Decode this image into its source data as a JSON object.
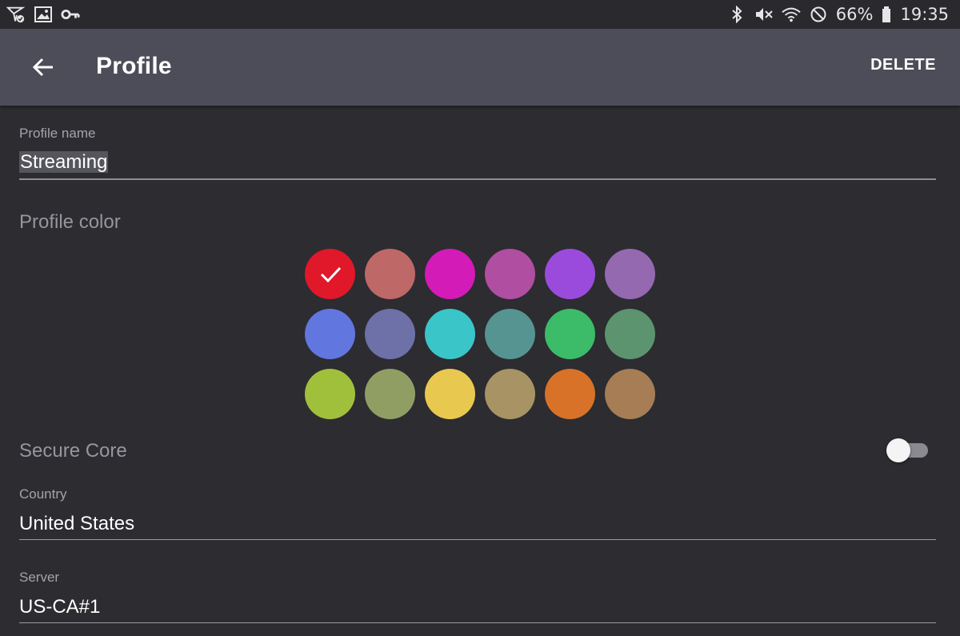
{
  "status_bar": {
    "left_icons": [
      "send-check-icon",
      "image-icon",
      "key-icon"
    ],
    "right_icons": [
      "bluetooth-icon",
      "mute-icon",
      "wifi-icon",
      "do-not-disturb-icon",
      "battery-icon"
    ],
    "battery": "66%",
    "time": "19:35"
  },
  "appbar": {
    "back_icon": "arrow-left-icon",
    "title": "Profile",
    "delete_label": "DELETE"
  },
  "profile_name": {
    "label": "Profile name",
    "value": "Streaming"
  },
  "profile_color": {
    "label": "Profile color",
    "selected_index": 0,
    "swatches": [
      "#e0182a",
      "#bf6868",
      "#d31bb7",
      "#b04ea2",
      "#9b4bdc",
      "#9469b0",
      "#6276e0",
      "#6d71a8",
      "#3ac5c9",
      "#559491",
      "#3cbb68",
      "#5c946f",
      "#a0c03c",
      "#909e64",
      "#e8c84e",
      "#a79364",
      "#d87228",
      "#a67d55"
    ]
  },
  "secure_core": {
    "label": "Secure Core",
    "enabled": false
  },
  "country": {
    "label": "Country",
    "value": "United States"
  },
  "server": {
    "label": "Server",
    "value": "US-CA#1"
  }
}
